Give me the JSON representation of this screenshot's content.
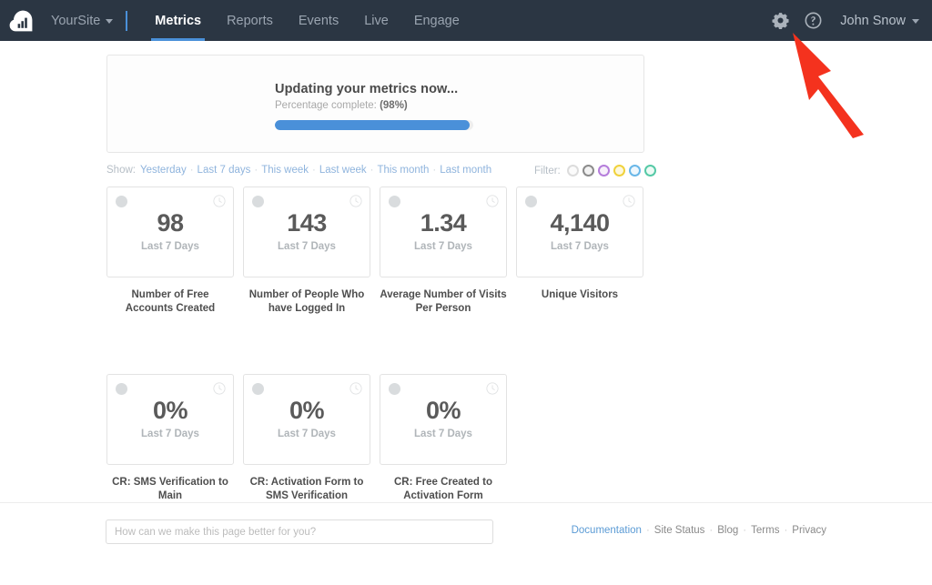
{
  "navbar": {
    "logo_icon": "cloud-bar-chart-logo",
    "site_label": "YourSite",
    "tabs": [
      {
        "label": "Metrics",
        "active": true
      },
      {
        "label": "Reports",
        "active": false
      },
      {
        "label": "Events",
        "active": false
      },
      {
        "label": "Live",
        "active": false
      },
      {
        "label": "Engage",
        "active": false
      }
    ],
    "settings_icon": "gear-icon",
    "help_icon": "help-circle-icon",
    "user_name": "John Snow",
    "bg_color": "#2b3643",
    "accent_color": "#4a90d9"
  },
  "update_panel": {
    "title": "Updating your metrics now...",
    "subtitle_prefix": "Percentage complete:",
    "subtitle_value": "(98%)",
    "progress_percent": 98,
    "progress_color": "#4a90d9"
  },
  "show_row": {
    "label": "Show:",
    "options": [
      "Yesterday",
      "Last 7 days",
      "This week",
      "Last week",
      "This month",
      "Last month"
    ]
  },
  "filter_row": {
    "label": "Filter:",
    "dots": [
      {
        "name": "filter-dot-white",
        "border": "#dcdcdc",
        "fill": "#fbfbfb"
      },
      {
        "name": "filter-dot-gray",
        "border": "#8b8b8b",
        "fill": "#f2f2f2"
      },
      {
        "name": "filter-dot-purple",
        "border": "#b57ddb",
        "fill": "#f7f0fb"
      },
      {
        "name": "filter-dot-yellow",
        "border": "#f0d23c",
        "fill": "#fdf8dd"
      },
      {
        "name": "filter-dot-blue",
        "border": "#69b7e8",
        "fill": "#eef7fd"
      },
      {
        "name": "filter-dot-teal",
        "border": "#55c9a6",
        "fill": "#edfaf5"
      }
    ]
  },
  "metrics": {
    "period_label": "Last 7 Days",
    "row1": [
      {
        "value": "98",
        "caption": "Number of Free Accounts Created"
      },
      {
        "value": "143",
        "caption": "Number of People Who have Logged In"
      },
      {
        "value": "1.34",
        "caption": "Average Number of Visits Per Person"
      },
      {
        "value": "4,140",
        "caption": "Unique Visitors"
      }
    ],
    "row2": [
      {
        "value": "0%",
        "caption": "CR: SMS Verification to Main"
      },
      {
        "value": "0%",
        "caption": "CR: Activation Form to SMS Verification"
      },
      {
        "value": "0%",
        "caption": "CR: Free Created to Activation Form"
      }
    ]
  },
  "footer": {
    "feedback_placeholder": "How can we make this page better for you?",
    "feedback_value": "",
    "links": [
      {
        "label": "Documentation",
        "primary": true
      },
      {
        "label": "Site Status",
        "primary": false
      },
      {
        "label": "Blog",
        "primary": false
      },
      {
        "label": "Terms",
        "primary": false
      },
      {
        "label": "Privacy",
        "primary": false
      }
    ]
  },
  "annotation": {
    "arrow_name": "red-pointer-arrow",
    "arrow_color": "#f4321e",
    "points_to": "gear-icon"
  }
}
